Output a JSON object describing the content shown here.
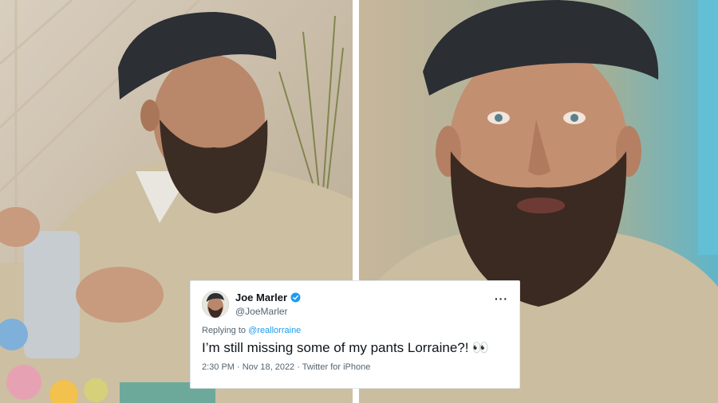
{
  "tweet": {
    "display_name": "Joe Marler",
    "handle": "@JoeMarler",
    "replying_prefix": "Replying to",
    "reply_to": "@reallorraine",
    "text": "I’m still missing some of my pants Lorraine?!",
    "emoji": "👀",
    "timestamp": "2:30 PM · Nov 18, 2022 · Twitter for iPhone",
    "more_icon": "more-icon",
    "verified_icon": "verified-badge-icon",
    "colors": {
      "link": "#1d9bf0",
      "secondary_text": "#536471",
      "primary_text": "#0f1419"
    }
  }
}
